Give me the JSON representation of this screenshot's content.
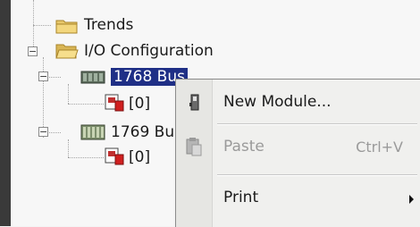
{
  "tree": {
    "nodes": [
      {
        "label": "Trends"
      },
      {
        "label": "I/O Configuration"
      },
      {
        "label": "1768 Bus"
      },
      {
        "label": "[0]"
      },
      {
        "label": "1769 Bu"
      },
      {
        "label": "[0]"
      }
    ]
  },
  "context_menu": {
    "items": [
      {
        "label": "New Module..."
      },
      {
        "label": "Paste",
        "shortcut": "Ctrl+V"
      },
      {
        "label": "Print"
      }
    ]
  }
}
